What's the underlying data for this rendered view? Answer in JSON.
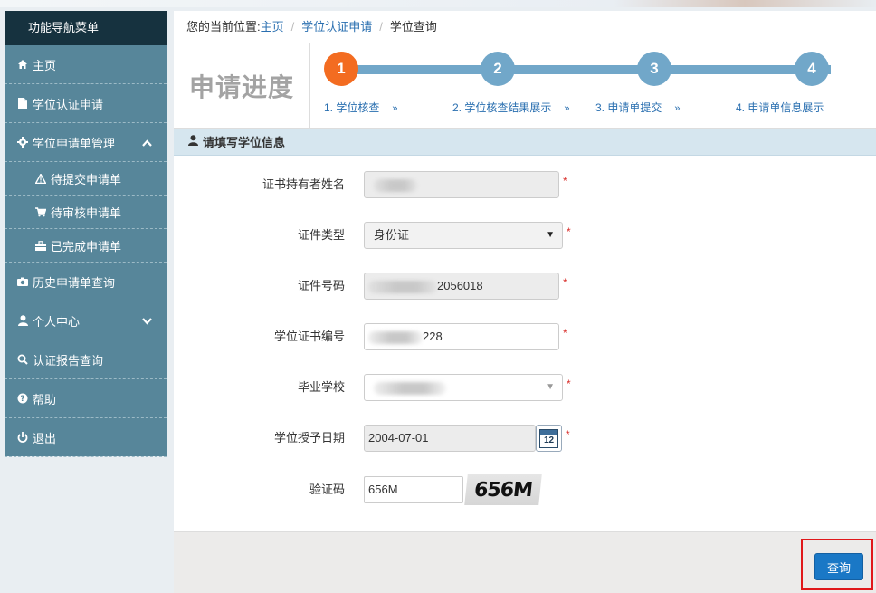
{
  "sidebar": {
    "title": "功能导航菜单",
    "items": [
      {
        "label": "主页",
        "icon": "home-icon"
      },
      {
        "label": "学位认证申请",
        "icon": "document-icon"
      },
      {
        "label": "学位申请单管理",
        "icon": "gear-icon",
        "chevron": "chevron-up-icon"
      },
      {
        "label": "待提交申请单",
        "icon": "warning-icon"
      },
      {
        "label": "待审核申请单",
        "icon": "cart-icon"
      },
      {
        "label": "已完成申请单",
        "icon": "briefcase-icon"
      },
      {
        "label": "历史申请单查询",
        "icon": "camera-icon"
      },
      {
        "label": "个人中心",
        "icon": "user-icon",
        "chevron": "chevron-down-icon"
      },
      {
        "label": "认证报告查询",
        "icon": "search-icon"
      },
      {
        "label": "帮助",
        "icon": "help-icon"
      },
      {
        "label": "退出",
        "icon": "power-icon"
      }
    ]
  },
  "breadcrumb": {
    "prefix": "您的当前位置:",
    "home": "主页",
    "parent": "学位认证申请",
    "current": "学位查询"
  },
  "progress": {
    "title": "申请进度",
    "steps": [
      {
        "num": "1",
        "label": "1. 学位核查"
      },
      {
        "num": "2",
        "label": "2. 学位核查结果展示"
      },
      {
        "num": "3",
        "label": "3. 申请单提交"
      },
      {
        "num": "4",
        "label": "4. 申请单信息展示"
      }
    ],
    "arrow": "»",
    "active_color": "#f36c21",
    "inactive_color": "#71a7c9"
  },
  "section": {
    "title": "请填写学位信息"
  },
  "form": {
    "name": {
      "label": "证书持有者姓名"
    },
    "id_type": {
      "label": "证件类型",
      "value": "身份证"
    },
    "id_number": {
      "label": "证件号码",
      "value": "2056018"
    },
    "cert_number": {
      "label": "学位证书编号",
      "value": "228"
    },
    "school": {
      "label": "毕业学校"
    },
    "grant_date": {
      "label": "学位授予日期",
      "value": "2004-07-01",
      "calendar_day": "12"
    },
    "captcha": {
      "label": "验证码",
      "value": "656M",
      "image_text": "656M"
    },
    "required_mark": "*"
  },
  "actions": {
    "query_label": "查询"
  }
}
